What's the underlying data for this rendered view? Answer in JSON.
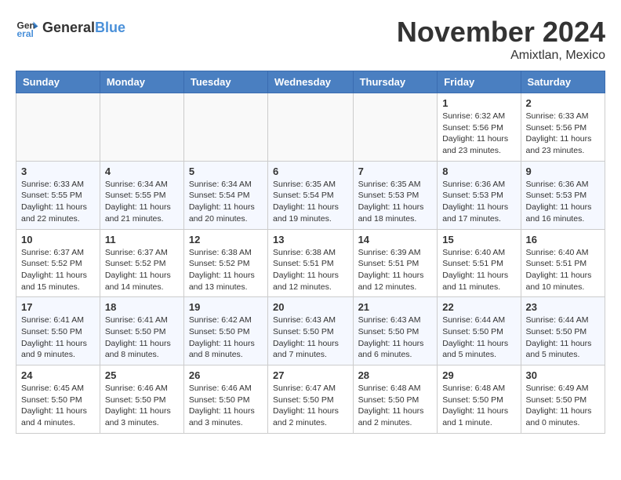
{
  "header": {
    "logo_general": "General",
    "logo_blue": "Blue",
    "month_title": "November 2024",
    "location": "Amixtlan, Mexico"
  },
  "weekdays": [
    "Sunday",
    "Monday",
    "Tuesday",
    "Wednesday",
    "Thursday",
    "Friday",
    "Saturday"
  ],
  "weeks": [
    [
      {
        "day": "",
        "info": ""
      },
      {
        "day": "",
        "info": ""
      },
      {
        "day": "",
        "info": ""
      },
      {
        "day": "",
        "info": ""
      },
      {
        "day": "",
        "info": ""
      },
      {
        "day": "1",
        "info": "Sunrise: 6:32 AM\nSunset: 5:56 PM\nDaylight: 11 hours and 23 minutes."
      },
      {
        "day": "2",
        "info": "Sunrise: 6:33 AM\nSunset: 5:56 PM\nDaylight: 11 hours and 23 minutes."
      }
    ],
    [
      {
        "day": "3",
        "info": "Sunrise: 6:33 AM\nSunset: 5:55 PM\nDaylight: 11 hours and 22 minutes."
      },
      {
        "day": "4",
        "info": "Sunrise: 6:34 AM\nSunset: 5:55 PM\nDaylight: 11 hours and 21 minutes."
      },
      {
        "day": "5",
        "info": "Sunrise: 6:34 AM\nSunset: 5:54 PM\nDaylight: 11 hours and 20 minutes."
      },
      {
        "day": "6",
        "info": "Sunrise: 6:35 AM\nSunset: 5:54 PM\nDaylight: 11 hours and 19 minutes."
      },
      {
        "day": "7",
        "info": "Sunrise: 6:35 AM\nSunset: 5:53 PM\nDaylight: 11 hours and 18 minutes."
      },
      {
        "day": "8",
        "info": "Sunrise: 6:36 AM\nSunset: 5:53 PM\nDaylight: 11 hours and 17 minutes."
      },
      {
        "day": "9",
        "info": "Sunrise: 6:36 AM\nSunset: 5:53 PM\nDaylight: 11 hours and 16 minutes."
      }
    ],
    [
      {
        "day": "10",
        "info": "Sunrise: 6:37 AM\nSunset: 5:52 PM\nDaylight: 11 hours and 15 minutes."
      },
      {
        "day": "11",
        "info": "Sunrise: 6:37 AM\nSunset: 5:52 PM\nDaylight: 11 hours and 14 minutes."
      },
      {
        "day": "12",
        "info": "Sunrise: 6:38 AM\nSunset: 5:52 PM\nDaylight: 11 hours and 13 minutes."
      },
      {
        "day": "13",
        "info": "Sunrise: 6:38 AM\nSunset: 5:51 PM\nDaylight: 11 hours and 12 minutes."
      },
      {
        "day": "14",
        "info": "Sunrise: 6:39 AM\nSunset: 5:51 PM\nDaylight: 11 hours and 12 minutes."
      },
      {
        "day": "15",
        "info": "Sunrise: 6:40 AM\nSunset: 5:51 PM\nDaylight: 11 hours and 11 minutes."
      },
      {
        "day": "16",
        "info": "Sunrise: 6:40 AM\nSunset: 5:51 PM\nDaylight: 11 hours and 10 minutes."
      }
    ],
    [
      {
        "day": "17",
        "info": "Sunrise: 6:41 AM\nSunset: 5:50 PM\nDaylight: 11 hours and 9 minutes."
      },
      {
        "day": "18",
        "info": "Sunrise: 6:41 AM\nSunset: 5:50 PM\nDaylight: 11 hours and 8 minutes."
      },
      {
        "day": "19",
        "info": "Sunrise: 6:42 AM\nSunset: 5:50 PM\nDaylight: 11 hours and 8 minutes."
      },
      {
        "day": "20",
        "info": "Sunrise: 6:43 AM\nSunset: 5:50 PM\nDaylight: 11 hours and 7 minutes."
      },
      {
        "day": "21",
        "info": "Sunrise: 6:43 AM\nSunset: 5:50 PM\nDaylight: 11 hours and 6 minutes."
      },
      {
        "day": "22",
        "info": "Sunrise: 6:44 AM\nSunset: 5:50 PM\nDaylight: 11 hours and 5 minutes."
      },
      {
        "day": "23",
        "info": "Sunrise: 6:44 AM\nSunset: 5:50 PM\nDaylight: 11 hours and 5 minutes."
      }
    ],
    [
      {
        "day": "24",
        "info": "Sunrise: 6:45 AM\nSunset: 5:50 PM\nDaylight: 11 hours and 4 minutes."
      },
      {
        "day": "25",
        "info": "Sunrise: 6:46 AM\nSunset: 5:50 PM\nDaylight: 11 hours and 3 minutes."
      },
      {
        "day": "26",
        "info": "Sunrise: 6:46 AM\nSunset: 5:50 PM\nDaylight: 11 hours and 3 minutes."
      },
      {
        "day": "27",
        "info": "Sunrise: 6:47 AM\nSunset: 5:50 PM\nDaylight: 11 hours and 2 minutes."
      },
      {
        "day": "28",
        "info": "Sunrise: 6:48 AM\nSunset: 5:50 PM\nDaylight: 11 hours and 2 minutes."
      },
      {
        "day": "29",
        "info": "Sunrise: 6:48 AM\nSunset: 5:50 PM\nDaylight: 11 hours and 1 minute."
      },
      {
        "day": "30",
        "info": "Sunrise: 6:49 AM\nSunset: 5:50 PM\nDaylight: 11 hours and 0 minutes."
      }
    ]
  ]
}
